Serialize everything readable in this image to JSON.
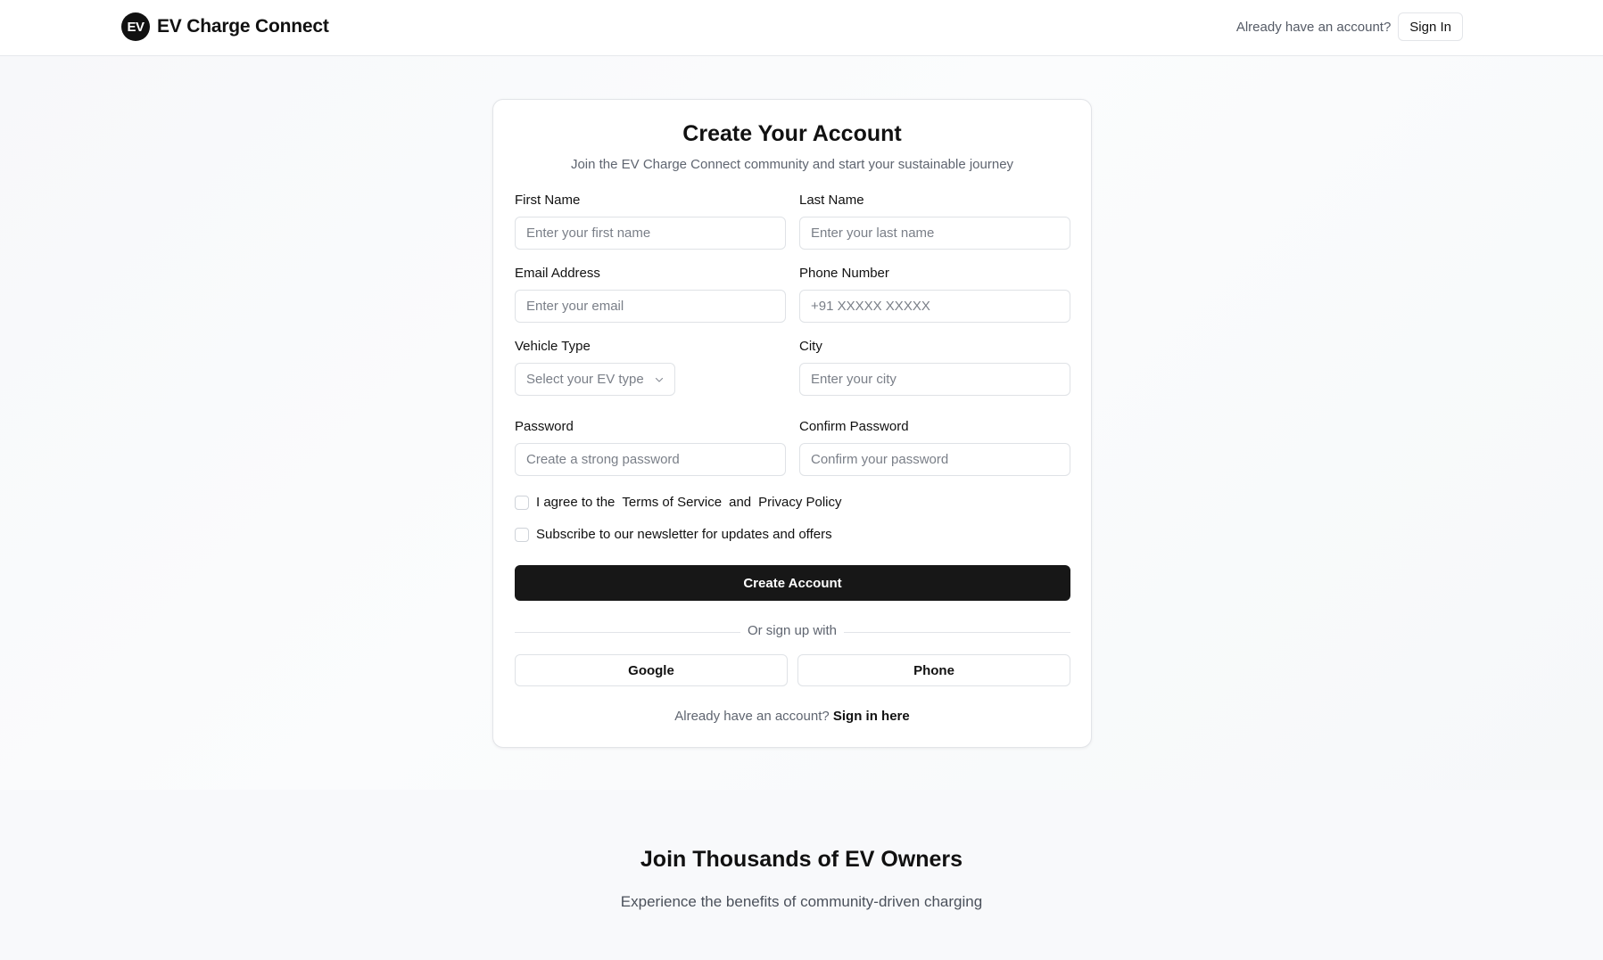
{
  "header": {
    "logo_badge": "EV",
    "brand": "EV Charge Connect",
    "prompt": "Already have an account?",
    "signin_label": "Sign In"
  },
  "form": {
    "title": "Create Your Account",
    "subtitle": "Join the EV Charge Connect community and start your sustainable journey",
    "first_name": {
      "label": "First Name",
      "placeholder": "Enter your first name",
      "value": ""
    },
    "last_name": {
      "label": "Last Name",
      "placeholder": "Enter your last name",
      "value": ""
    },
    "email": {
      "label": "Email Address",
      "placeholder": "Enter your email",
      "value": ""
    },
    "phone": {
      "label": "Phone Number",
      "placeholder": "+91 XXXXX XXXXX",
      "value": ""
    },
    "vehicle": {
      "label": "Vehicle Type",
      "selected": "Select your EV type"
    },
    "city": {
      "label": "City",
      "placeholder": "Enter your city",
      "value": ""
    },
    "password": {
      "label": "Password",
      "placeholder": "Create a strong password",
      "value": ""
    },
    "confirm_password": {
      "label": "Confirm Password",
      "placeholder": "Confirm your password",
      "value": ""
    },
    "terms": {
      "prefix": "I agree to the",
      "terms_link": "Terms of Service",
      "and": "and",
      "privacy_link": "Privacy Policy",
      "checked": false
    },
    "newsletter": {
      "label": "Subscribe to our newsletter for updates and offers",
      "checked": false
    },
    "submit_label": "Create Account",
    "divider_text": "Or sign up with",
    "google_label": "Google",
    "phone_label": "Phone",
    "bottom_prompt": "Already have an account?",
    "bottom_link": "Sign in here"
  },
  "lower": {
    "title": "Join Thousands of EV Owners",
    "subtitle": "Experience the benefits of community-driven charging"
  },
  "colors": {
    "primary_button": "#171717",
    "border": "#dfe2e6",
    "muted_text": "#5f6570"
  }
}
